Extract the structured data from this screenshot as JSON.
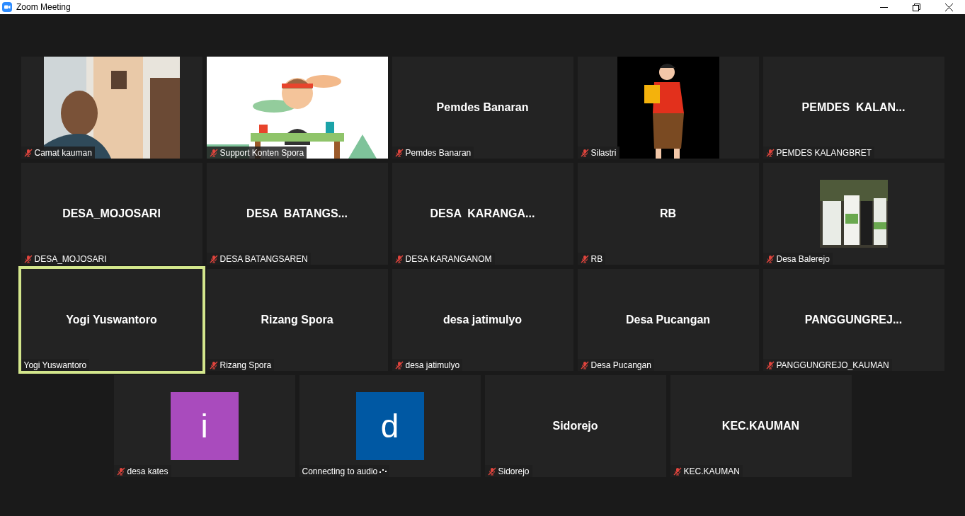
{
  "window": {
    "title": "Zoom Meeting"
  },
  "tiles": [
    {
      "kind": "picture",
      "label": "Camat kauman",
      "muted": true,
      "speaking": false,
      "connecting": false
    },
    {
      "kind": "picture",
      "label": "Support Konten Spora",
      "muted": true,
      "speaking": false,
      "connecting": false
    },
    {
      "kind": "name",
      "title": "Pemdes Banaran",
      "label": "Pemdes Banaran",
      "muted": true,
      "speaking": false,
      "connecting": false
    },
    {
      "kind": "picture",
      "label": "Silastri",
      "muted": true,
      "speaking": false,
      "connecting": false
    },
    {
      "kind": "name",
      "title": "PEMDES  KALAN...",
      "label": "PEMDES KALANGBRET",
      "muted": true,
      "speaking": false,
      "connecting": false
    },
    {
      "kind": "name",
      "title": "DESA_MOJOSARI",
      "label": "DESA_MOJOSARI",
      "muted": true,
      "speaking": false,
      "connecting": false
    },
    {
      "kind": "name",
      "title": "DESA  BATANGS...",
      "label": "DESA BATANGSAREN",
      "muted": true,
      "speaking": false,
      "connecting": false
    },
    {
      "kind": "name",
      "title": "DESA  KARANGA...",
      "label": "DESA KARANGANOM",
      "muted": true,
      "speaking": false,
      "connecting": false
    },
    {
      "kind": "name",
      "title": "RB",
      "label": "RB",
      "muted": true,
      "speaking": false,
      "connecting": false
    },
    {
      "kind": "picture",
      "label": "Desa Balerejo",
      "muted": true,
      "speaking": false,
      "connecting": false
    },
    {
      "kind": "name",
      "title": "Yogi Yuswantoro",
      "label": "Yogi Yuswantoro",
      "muted": false,
      "speaking": true,
      "connecting": false
    },
    {
      "kind": "name",
      "title": "Rizang Spora",
      "label": "Rizang Spora",
      "muted": true,
      "speaking": false,
      "connecting": false
    },
    {
      "kind": "name",
      "title": "desa jatimulyo",
      "label": "desa jatimulyo",
      "muted": true,
      "speaking": false,
      "connecting": false
    },
    {
      "kind": "name",
      "title": "Desa Pucangan",
      "label": "Desa Pucangan",
      "muted": true,
      "speaking": false,
      "connecting": false
    },
    {
      "kind": "name",
      "title": "PANGGUNGREJ...",
      "label": "PANGGUNGREJO_KAUMAN",
      "muted": true,
      "speaking": false,
      "connecting": false
    },
    {
      "kind": "avatar",
      "letter": "i",
      "color": "#a94bbd",
      "label": "desa kates",
      "muted": true,
      "speaking": false,
      "connecting": false
    },
    {
      "kind": "avatar",
      "letter": "d",
      "color": "#0058a3",
      "label": "Connecting to audio",
      "muted": false,
      "speaking": false,
      "connecting": true
    },
    {
      "kind": "name",
      "title": "Sidorejo",
      "label": "Sidorejo",
      "muted": true,
      "speaking": false,
      "connecting": false
    },
    {
      "kind": "name",
      "title": "KEC.KAUMAN",
      "label": "KEC.KAUMAN",
      "muted": true,
      "speaking": false,
      "connecting": false
    }
  ]
}
